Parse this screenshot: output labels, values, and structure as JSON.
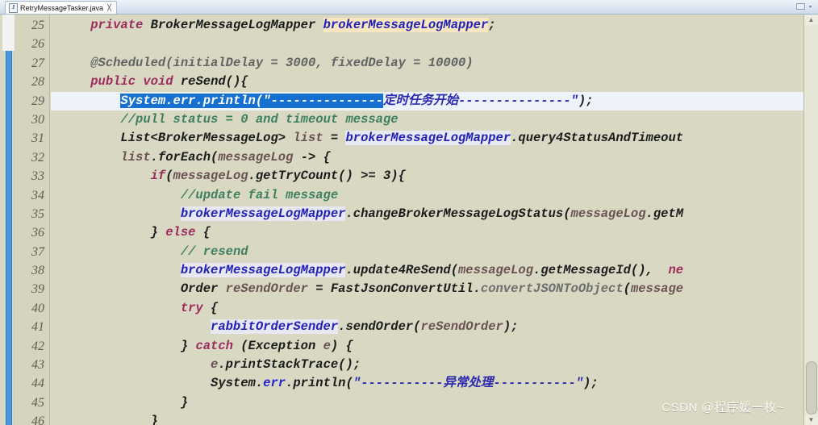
{
  "window": {
    "tab_label": "RetryMessageTasker.java",
    "tab_icon": "java-file-icon",
    "tab_close_glyph": "╳",
    "minimize_glyph": "▭",
    "maximize_glyph": "▪"
  },
  "colors": {
    "editor_background": "#d9d9c3",
    "gutter_background": "#d5d5bf",
    "selection": "#1670d0",
    "current_line": "#eef2fb",
    "field_highlight": "#f7e6c0",
    "keyword": "#9c2b5e",
    "comment": "#3f7f5f",
    "string": "#2a2ab0",
    "field": "#2222b8",
    "variable": "#6b5252",
    "marker_bar": "#4a97e0"
  },
  "gutter": {
    "line_numbers": [
      "25",
      "26",
      "27",
      "28",
      "29",
      "30",
      "31",
      "32",
      "33",
      "34",
      "35",
      "36",
      "37",
      "38",
      "39",
      "40",
      "41",
      "42",
      "43",
      "44",
      "45",
      "46"
    ]
  },
  "overview_ruler": {
    "scroll_up_glyph": "▲",
    "scroll_down_glyph": "▼"
  },
  "watermark": {
    "text": "CSDN @程序媛一枚~"
  },
  "code": {
    "lines": [
      {
        "n": "25",
        "tokens": [
          {
            "t": "    ",
            "c": ""
          },
          {
            "t": "private",
            "c": "kw"
          },
          {
            "t": " ",
            "c": ""
          },
          {
            "t": "BrokerMessageLogMapper",
            "c": "type"
          },
          {
            "t": " ",
            "c": ""
          },
          {
            "t": "brokerMessageLogMapper",
            "c": "fld"
          },
          {
            "t": ";",
            "c": ""
          }
        ]
      },
      {
        "n": "26",
        "tokens": []
      },
      {
        "n": "27",
        "tokens": [
          {
            "t": "    ",
            "c": ""
          },
          {
            "t": "@Scheduled(initialDelay = 3000, fixedDelay = 10000)",
            "c": "ann"
          }
        ]
      },
      {
        "n": "28",
        "tokens": [
          {
            "t": "    ",
            "c": ""
          },
          {
            "t": "public",
            "c": "kw"
          },
          {
            "t": " ",
            "c": ""
          },
          {
            "t": "void",
            "c": "kw"
          },
          {
            "t": " reSend(){",
            "c": ""
          }
        ]
      },
      {
        "n": "29",
        "selected_row": true,
        "tokens": [
          {
            "t": "        ",
            "c": ""
          },
          {
            "t": "System.err.println(\"---------------",
            "c": "sel"
          },
          {
            "t": "定时任务开始---------------\"",
            "c": "str"
          },
          {
            "t": ");",
            "c": ""
          }
        ]
      },
      {
        "n": "30",
        "tokens": [
          {
            "t": "        ",
            "c": ""
          },
          {
            "t": "//pull status = 0 and timeout message",
            "c": "cmt"
          }
        ]
      },
      {
        "n": "31",
        "tokens": [
          {
            "t": "        ",
            "c": ""
          },
          {
            "t": "List<BrokerMessageLog> ",
            "c": ""
          },
          {
            "t": "list",
            "c": "var"
          },
          {
            "t": " = ",
            "c": ""
          },
          {
            "t": "brokerMessageLogMapper",
            "c": "fldp"
          },
          {
            "t": ".query4StatusAndTimeout",
            "c": ""
          }
        ]
      },
      {
        "n": "32",
        "tokens": [
          {
            "t": "        ",
            "c": ""
          },
          {
            "t": "list",
            "c": "var"
          },
          {
            "t": ".forEach(",
            "c": ""
          },
          {
            "t": "messageLog",
            "c": "var"
          },
          {
            "t": " -> {",
            "c": ""
          }
        ]
      },
      {
        "n": "33",
        "tokens": [
          {
            "t": "            ",
            "c": ""
          },
          {
            "t": "if",
            "c": "kw"
          },
          {
            "t": "(",
            "c": ""
          },
          {
            "t": "messageLog",
            "c": "var"
          },
          {
            "t": ".getTryCount() >= 3){",
            "c": ""
          }
        ]
      },
      {
        "n": "34",
        "tokens": [
          {
            "t": "                ",
            "c": ""
          },
          {
            "t": "//update fail message",
            "c": "cmt"
          }
        ]
      },
      {
        "n": "35",
        "tokens": [
          {
            "t": "                ",
            "c": ""
          },
          {
            "t": "brokerMessageLogMapper",
            "c": "fldp"
          },
          {
            "t": ".changeBrokerMessageLogStatus(",
            "c": ""
          },
          {
            "t": "messageLog",
            "c": "var"
          },
          {
            "t": ".getM",
            "c": ""
          }
        ]
      },
      {
        "n": "36",
        "tokens": [
          {
            "t": "            } ",
            "c": ""
          },
          {
            "t": "else",
            "c": "kw"
          },
          {
            "t": " {",
            "c": ""
          }
        ]
      },
      {
        "n": "37",
        "tokens": [
          {
            "t": "                ",
            "c": ""
          },
          {
            "t": "// resend",
            "c": "cmt"
          }
        ]
      },
      {
        "n": "38",
        "tokens": [
          {
            "t": "                ",
            "c": ""
          },
          {
            "t": "brokerMessageLogMapper",
            "c": "fldp"
          },
          {
            "t": ".update4ReSend(",
            "c": ""
          },
          {
            "t": "messageLog",
            "c": "var"
          },
          {
            "t": ".getMessageId(),  ",
            "c": ""
          },
          {
            "t": "ne",
            "c": "kw"
          }
        ]
      },
      {
        "n": "39",
        "tokens": [
          {
            "t": "                ",
            "c": ""
          },
          {
            "t": "Order ",
            "c": ""
          },
          {
            "t": "reSendOrder",
            "c": "var"
          },
          {
            "t": " = FastJsonConvertUtil.",
            "c": ""
          },
          {
            "t": "convertJSONToObject",
            "c": "gry"
          },
          {
            "t": "(",
            "c": ""
          },
          {
            "t": "message",
            "c": "var"
          }
        ]
      },
      {
        "n": "40",
        "tokens": [
          {
            "t": "                ",
            "c": ""
          },
          {
            "t": "try",
            "c": "kw"
          },
          {
            "t": " {",
            "c": ""
          }
        ]
      },
      {
        "n": "41",
        "tokens": [
          {
            "t": "                    ",
            "c": ""
          },
          {
            "t": "rabbitOrderSender",
            "c": "fldp"
          },
          {
            "t": ".sendOrder(",
            "c": ""
          },
          {
            "t": "reSendOrder",
            "c": "var"
          },
          {
            "t": ");",
            "c": ""
          }
        ]
      },
      {
        "n": "42",
        "tokens": [
          {
            "t": "                } ",
            "c": ""
          },
          {
            "t": "catch",
            "c": "kw"
          },
          {
            "t": " (Exception ",
            "c": ""
          },
          {
            "t": "e",
            "c": "var"
          },
          {
            "t": ") {",
            "c": ""
          }
        ]
      },
      {
        "n": "43",
        "tokens": [
          {
            "t": "                    ",
            "c": ""
          },
          {
            "t": "e",
            "c": "var"
          },
          {
            "t": ".printStackTrace();",
            "c": ""
          }
        ]
      },
      {
        "n": "44",
        "tokens": [
          {
            "t": "                    ",
            "c": ""
          },
          {
            "t": "System.",
            "c": ""
          },
          {
            "t": "err",
            "c": "stat"
          },
          {
            "t": ".println(",
            "c": ""
          },
          {
            "t": "\"-----------异常处理-----------\"",
            "c": "str"
          },
          {
            "t": ");",
            "c": ""
          }
        ]
      },
      {
        "n": "45",
        "tokens": [
          {
            "t": "                }",
            "c": ""
          }
        ]
      },
      {
        "n": "46",
        "tokens": [
          {
            "t": "            }",
            "c": ""
          }
        ]
      }
    ]
  }
}
